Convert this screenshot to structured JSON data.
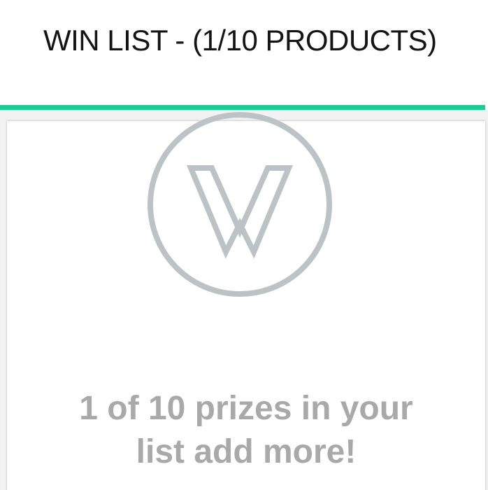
{
  "header": {
    "title": "WIN LIST - (1/10 PRODUCTS)"
  },
  "colors": {
    "accent": "#1fc99a",
    "logo": "#bcc3c6",
    "message": "#a9a9a9"
  },
  "empty_state": {
    "logo_icon": "w-logo-icon",
    "message_line1": "1 of 10 prizes in your",
    "message_line2": "list add more!"
  }
}
